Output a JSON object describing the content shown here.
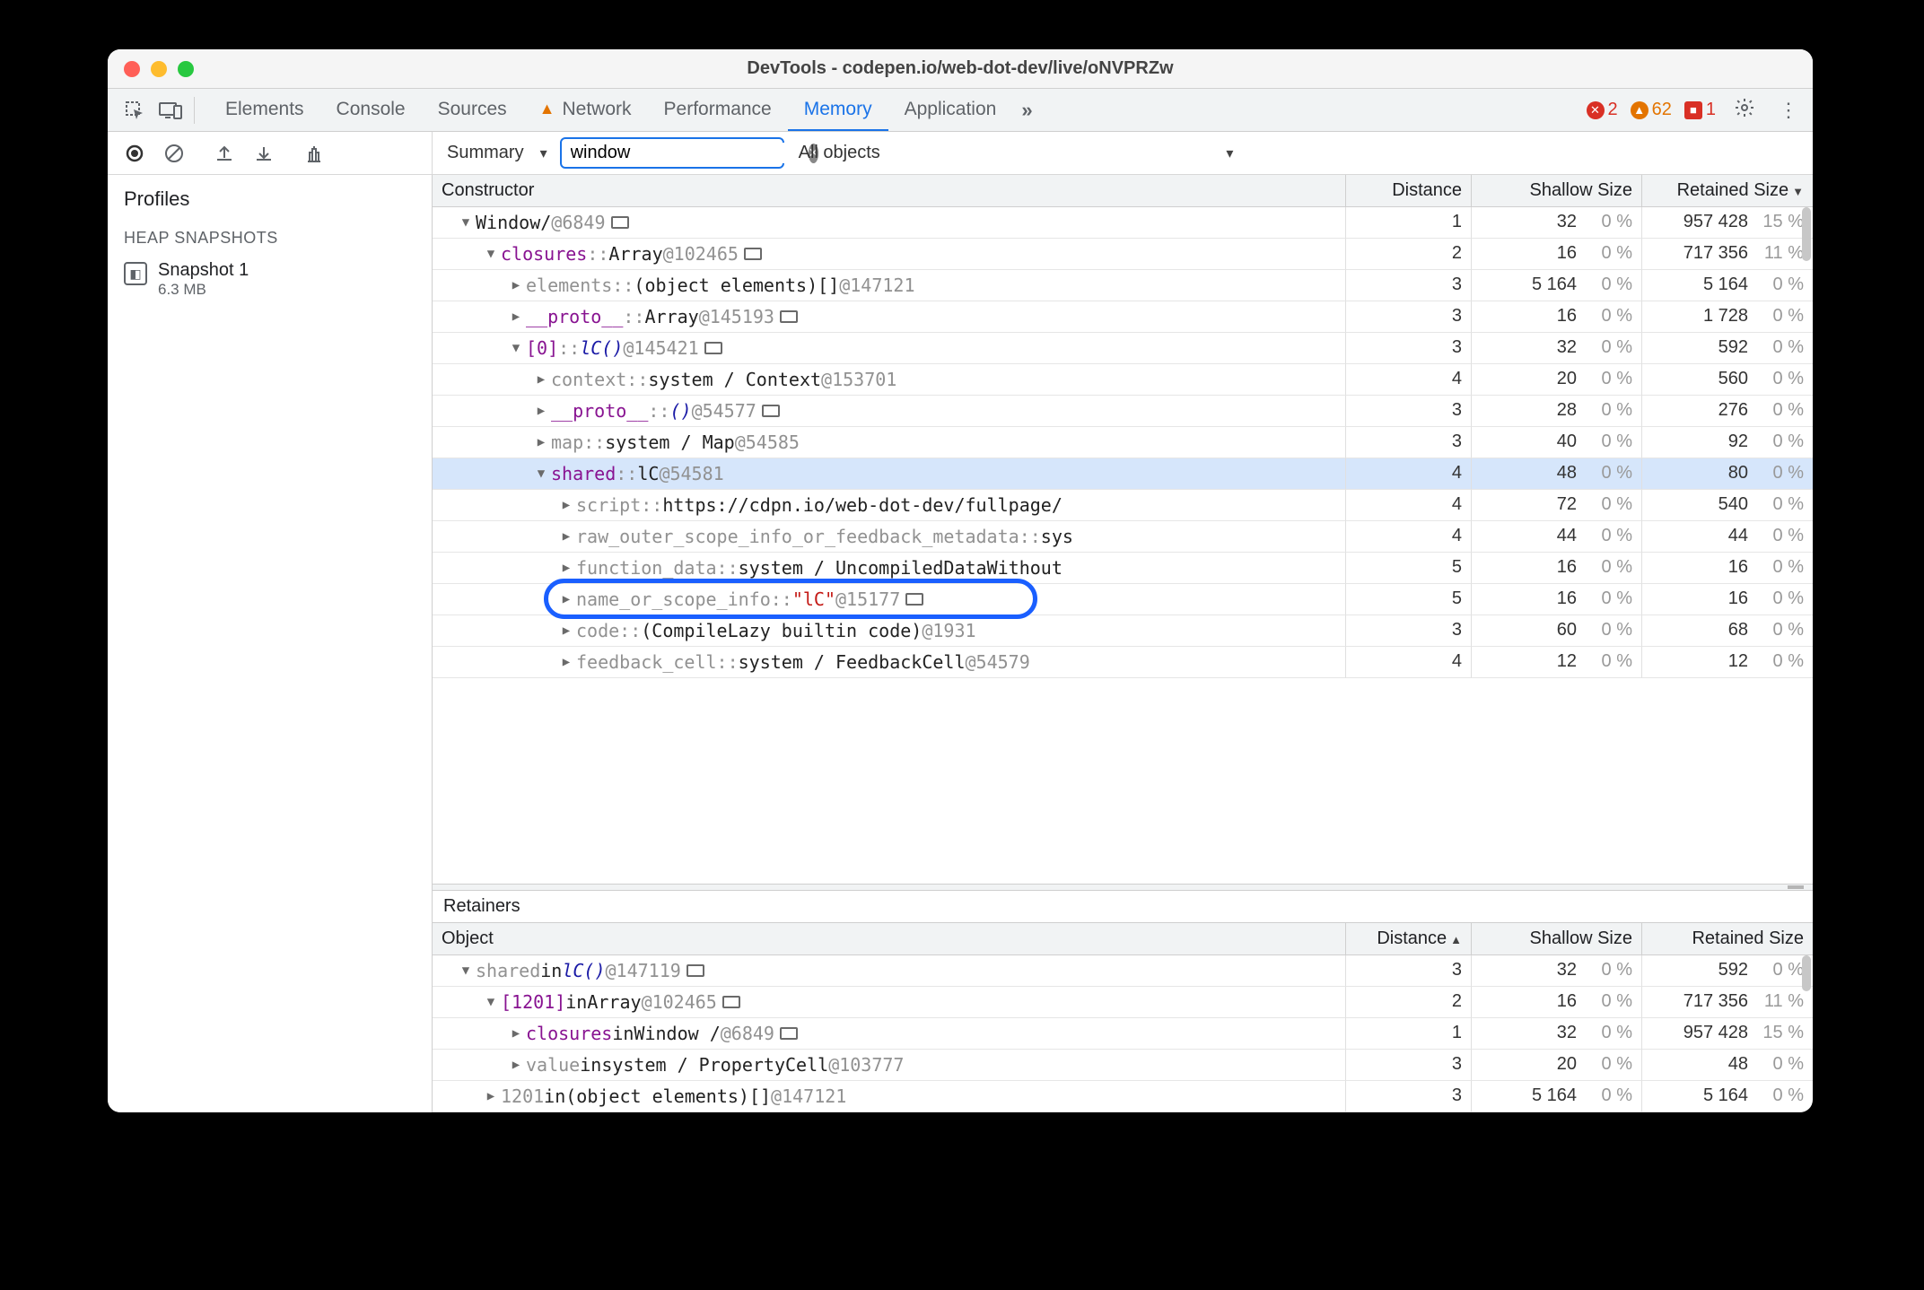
{
  "window": {
    "title": "DevTools - codepen.io/web-dot-dev/live/oNVPRZw"
  },
  "tabs": {
    "items": [
      "Elements",
      "Console",
      "Sources",
      "Network",
      "Performance",
      "Memory",
      "Application"
    ],
    "active": "Memory",
    "network_has_warning": true,
    "more": "»"
  },
  "status": {
    "errors": 2,
    "warnings": 62,
    "issues": 1
  },
  "toolbar": {
    "view": "Summary",
    "filter_value": "window",
    "scope": "All objects"
  },
  "sidebar": {
    "profiles_label": "Profiles",
    "section_label": "HEAP SNAPSHOTS",
    "snapshot": {
      "name": "Snapshot 1",
      "size": "6.3 MB"
    }
  },
  "columns": {
    "constructor": "Constructor",
    "distance": "Distance",
    "shallow": "Shallow Size",
    "retained": "Retained Size"
  },
  "rows": [
    {
      "indent": 0,
      "tri": "expanded",
      "parts": [
        {
          "t": "Window",
          "c": "black"
        },
        {
          "t": " / ",
          "c": "black"
        },
        {
          "t": "   @6849",
          "c": "gray"
        }
      ],
      "rect": true,
      "dist": "1",
      "sh": "32",
      "shp": "0 %",
      "re": "957 428",
      "rep": "15 %"
    },
    {
      "indent": 1,
      "tri": "expanded",
      "parts": [
        {
          "t": "closures",
          "c": "purple"
        },
        {
          "t": " :: ",
          "c": "gray"
        },
        {
          "t": "Array ",
          "c": "black"
        },
        {
          "t": "@102465",
          "c": "gray"
        }
      ],
      "rect": true,
      "dist": "2",
      "sh": "16",
      "shp": "0 %",
      "re": "717 356",
      "rep": "11 %"
    },
    {
      "indent": 2,
      "tri": "collapsed",
      "parts": [
        {
          "t": "elements",
          "c": "gray"
        },
        {
          "t": " :: ",
          "c": "gray"
        },
        {
          "t": "(object elements)[] ",
          "c": "black"
        },
        {
          "t": "@147121",
          "c": "gray"
        }
      ],
      "dist": "3",
      "sh": "5 164",
      "shp": "0 %",
      "re": "5 164",
      "rep": "0 %"
    },
    {
      "indent": 2,
      "tri": "collapsed",
      "parts": [
        {
          "t": "__proto__",
          "c": "purple"
        },
        {
          "t": " :: ",
          "c": "gray"
        },
        {
          "t": "Array ",
          "c": "black"
        },
        {
          "t": "@145193",
          "c": "gray"
        }
      ],
      "rect": true,
      "dist": "3",
      "sh": "16",
      "shp": "0 %",
      "re": "1 728",
      "rep": "0 %"
    },
    {
      "indent": 2,
      "tri": "expanded",
      "parts": [
        {
          "t": "[0]",
          "c": "purple"
        },
        {
          "t": " :: ",
          "c": "gray"
        },
        {
          "t": "lC()",
          "c": "blue",
          "italic": true
        },
        {
          "t": " @145421",
          "c": "gray"
        }
      ],
      "rect": true,
      "dist": "3",
      "sh": "32",
      "shp": "0 %",
      "re": "592",
      "rep": "0 %"
    },
    {
      "indent": 3,
      "tri": "collapsed",
      "parts": [
        {
          "t": "context",
          "c": "gray"
        },
        {
          "t": " :: ",
          "c": "gray"
        },
        {
          "t": "system / Context ",
          "c": "black"
        },
        {
          "t": "@153701",
          "c": "gray"
        }
      ],
      "dist": "4",
      "sh": "20",
      "shp": "0 %",
      "re": "560",
      "rep": "0 %"
    },
    {
      "indent": 3,
      "tri": "collapsed",
      "parts": [
        {
          "t": "__proto__",
          "c": "purple"
        },
        {
          "t": " :: ",
          "c": "gray"
        },
        {
          "t": "()",
          "c": "blue",
          "italic": true
        },
        {
          "t": " @54577",
          "c": "gray"
        }
      ],
      "rect": true,
      "dist": "3",
      "sh": "28",
      "shp": "0 %",
      "re": "276",
      "rep": "0 %"
    },
    {
      "indent": 3,
      "tri": "collapsed",
      "parts": [
        {
          "t": "map",
          "c": "gray"
        },
        {
          "t": " :: ",
          "c": "gray"
        },
        {
          "t": "system / Map ",
          "c": "black"
        },
        {
          "t": "@54585",
          "c": "gray"
        }
      ],
      "dist": "3",
      "sh": "40",
      "shp": "0 %",
      "re": "92",
      "rep": "0 %"
    },
    {
      "indent": 3,
      "tri": "expanded",
      "sel": true,
      "parts": [
        {
          "t": "shared",
          "c": "purple"
        },
        {
          "t": " :: ",
          "c": "gray"
        },
        {
          "t": "lC ",
          "c": "black"
        },
        {
          "t": "@54581",
          "c": "gray"
        }
      ],
      "dist": "4",
      "sh": "48",
      "shp": "0 %",
      "re": "80",
      "rep": "0 %"
    },
    {
      "indent": 4,
      "tri": "collapsed",
      "parts": [
        {
          "t": "script",
          "c": "gray"
        },
        {
          "t": " :: ",
          "c": "gray"
        },
        {
          "t": "https://cdpn.io/web-dot-dev/fullpage/",
          "c": "black"
        }
      ],
      "dist": "4",
      "sh": "72",
      "shp": "0 %",
      "re": "540",
      "rep": "0 %"
    },
    {
      "indent": 4,
      "tri": "collapsed",
      "parts": [
        {
          "t": "raw_outer_scope_info_or_feedback_metadata",
          "c": "gray"
        },
        {
          "t": " :: ",
          "c": "gray"
        },
        {
          "t": "sys",
          "c": "black"
        }
      ],
      "dist": "4",
      "sh": "44",
      "shp": "0 %",
      "re": "44",
      "rep": "0 %"
    },
    {
      "indent": 4,
      "tri": "collapsed",
      "parts": [
        {
          "t": "function_data",
          "c": "gray"
        },
        {
          "t": " :: ",
          "c": "gray"
        },
        {
          "t": "system / UncompiledDataWithout",
          "c": "black"
        }
      ],
      "dist": "5",
      "sh": "16",
      "shp": "0 %",
      "re": "16",
      "rep": "0 %"
    },
    {
      "indent": 4,
      "tri": "collapsed",
      "hl": true,
      "parts": [
        {
          "t": "name_or_scope_info",
          "c": "gray"
        },
        {
          "t": " :: ",
          "c": "gray"
        },
        {
          "t": "\"lC\" ",
          "c": "red"
        },
        {
          "t": "@15177",
          "c": "gray"
        }
      ],
      "rect": true,
      "dist": "5",
      "sh": "16",
      "shp": "0 %",
      "re": "16",
      "rep": "0 %"
    },
    {
      "indent": 4,
      "tri": "collapsed",
      "parts": [
        {
          "t": "code",
          "c": "gray"
        },
        {
          "t": " :: ",
          "c": "gray"
        },
        {
          "t": "(CompileLazy builtin code) ",
          "c": "black"
        },
        {
          "t": "@1931",
          "c": "gray"
        }
      ],
      "dist": "3",
      "sh": "60",
      "shp": "0 %",
      "re": "68",
      "rep": "0 %"
    },
    {
      "indent": 4,
      "tri": "collapsed",
      "parts": [
        {
          "t": "feedback_cell",
          "c": "gray"
        },
        {
          "t": " :: ",
          "c": "gray"
        },
        {
          "t": "system / FeedbackCell ",
          "c": "black"
        },
        {
          "t": "@54579",
          "c": "gray"
        }
      ],
      "dist": "4",
      "sh": "12",
      "shp": "0 %",
      "re": "12",
      "rep": "0 %"
    }
  ],
  "retainers": {
    "label": "Retainers",
    "columns": {
      "object": "Object",
      "distance": "Distance",
      "shallow": "Shallow Size",
      "retained": "Retained Size"
    },
    "rows": [
      {
        "indent": 0,
        "tri": "expanded",
        "parts": [
          {
            "t": "shared",
            "c": "gray"
          },
          {
            "t": " in ",
            "c": "black"
          },
          {
            "t": "lC()",
            "c": "blue",
            "italic": true
          },
          {
            "t": " @147119",
            "c": "gray"
          }
        ],
        "rect": true,
        "dist": "3",
        "sh": "32",
        "shp": "0 %",
        "re": "592",
        "rep": "0 %"
      },
      {
        "indent": 1,
        "tri": "expanded",
        "parts": [
          {
            "t": "[1201]",
            "c": "purple"
          },
          {
            "t": " in ",
            "c": "black"
          },
          {
            "t": "Array ",
            "c": "black"
          },
          {
            "t": "@102465",
            "c": "gray"
          }
        ],
        "rect": true,
        "dist": "2",
        "sh": "16",
        "shp": "0 %",
        "re": "717 356",
        "rep": "11 %"
      },
      {
        "indent": 2,
        "tri": "collapsed",
        "parts": [
          {
            "t": "closures",
            "c": "purple"
          },
          {
            "t": " in ",
            "c": "black"
          },
          {
            "t": "Window / ",
            "c": "black"
          },
          {
            "t": "  @6849",
            "c": "gray"
          }
        ],
        "rect": true,
        "dist": "1",
        "sh": "32",
        "shp": "0 %",
        "re": "957 428",
        "rep": "15 %"
      },
      {
        "indent": 2,
        "tri": "collapsed",
        "parts": [
          {
            "t": "value",
            "c": "gray"
          },
          {
            "t": " in ",
            "c": "black"
          },
          {
            "t": "system / PropertyCell ",
            "c": "black"
          },
          {
            "t": "@103777",
            "c": "gray"
          }
        ],
        "dist": "3",
        "sh": "20",
        "shp": "0 %",
        "re": "48",
        "rep": "0 %"
      },
      {
        "indent": 1,
        "tri": "collapsed",
        "parts": [
          {
            "t": "1201",
            "c": "gray"
          },
          {
            "t": " in ",
            "c": "black"
          },
          {
            "t": "(object elements)[] ",
            "c": "black"
          },
          {
            "t": "@147121",
            "c": "gray"
          }
        ],
        "dist": "3",
        "sh": "5 164",
        "shp": "0 %",
        "re": "5 164",
        "rep": "0 %"
      }
    ]
  }
}
